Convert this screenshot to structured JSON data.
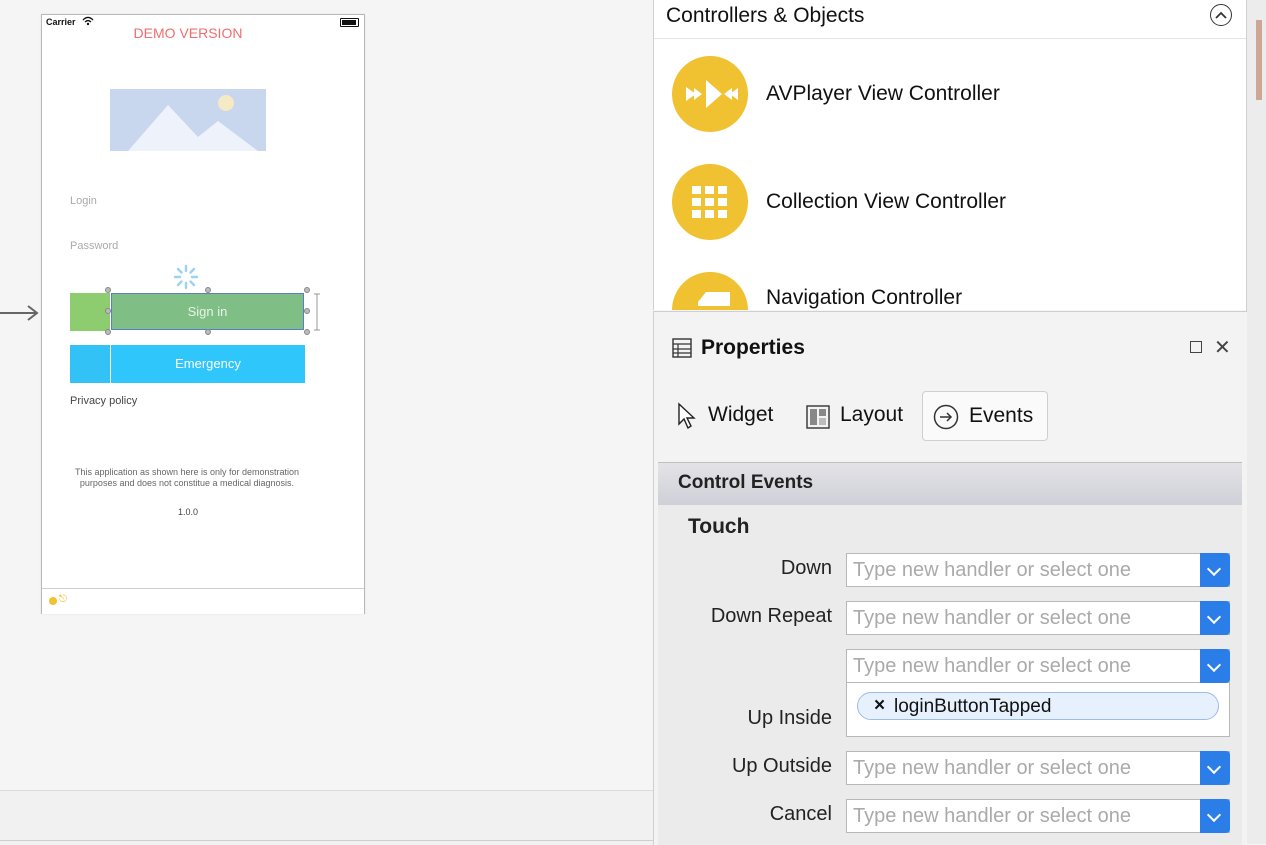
{
  "phone": {
    "carrier": "Carrier",
    "demo_label": "DEMO VERSION",
    "login_placeholder": "Login",
    "password_placeholder": "Password",
    "signin_label": "Sign in",
    "emergency_label": "Emergency",
    "privacy_label": "Privacy policy",
    "disclaimer": "This application as shown here is only for demonstration purposes and does not constitue a medical diagnosis.",
    "version": "1.0.0"
  },
  "library": {
    "title": "Controllers & Objects",
    "items": [
      {
        "label": "AVPlayer View Controller",
        "icon": "av-player-icon"
      },
      {
        "label": "Collection View Controller",
        "icon": "grid-icon"
      },
      {
        "label": "Navigation Controller",
        "icon": "navigation-icon"
      }
    ]
  },
  "properties": {
    "title": "Properties",
    "tabs": [
      {
        "label": "Widget",
        "icon": "cursor-icon"
      },
      {
        "label": "Layout",
        "icon": "layout-icon"
      },
      {
        "label": "Events",
        "icon": "events-icon",
        "selected": true
      }
    ],
    "section_title": "Control Events",
    "group_title": "Touch",
    "placeholder": "Type new handler or select one",
    "events": [
      {
        "label": "Down"
      },
      {
        "label": "Down Repeat"
      },
      {
        "label": "Up Inside",
        "handler": "loginButtonTapped"
      },
      {
        "label": "Up Outside"
      },
      {
        "label": "Cancel"
      }
    ]
  },
  "colors": {
    "accent": "#2b7ee8",
    "library_icon": "#f0c130",
    "signin_green": "#7fbf86",
    "emergency_blue": "#2ec6fb",
    "demo_red": "#f26d6d"
  }
}
